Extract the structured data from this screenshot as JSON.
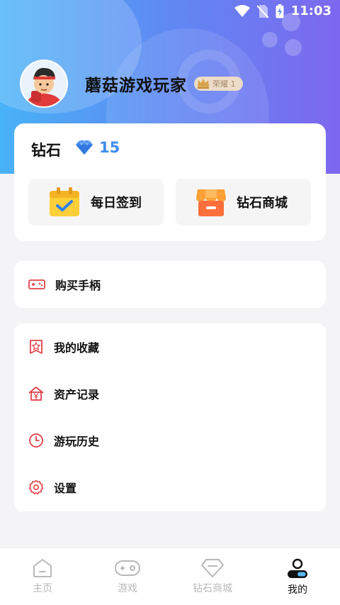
{
  "status_bar": {
    "time": "11:03"
  },
  "profile": {
    "username": "蘑菇游戏玩家",
    "badge_label": "荣耀 1"
  },
  "diamonds": {
    "label": "钻石",
    "count": "15",
    "actions": [
      {
        "label": "每日签到",
        "icon": "calendar-check-icon"
      },
      {
        "label": "钻石商城",
        "icon": "shop-icon"
      }
    ]
  },
  "menu_group_1": [
    {
      "label": "购买手柄",
      "icon": "gamepad-icon"
    }
  ],
  "menu_group_2": [
    {
      "label": "我的收藏",
      "icon": "star-bookmark-icon"
    },
    {
      "label": "资产记录",
      "icon": "asset-record-icon"
    },
    {
      "label": "游玩历史",
      "icon": "clock-icon"
    },
    {
      "label": "设置",
      "icon": "gear-icon"
    }
  ],
  "bottom_nav": [
    {
      "label": "主页",
      "icon": "home-icon",
      "active": false
    },
    {
      "label": "游戏",
      "icon": "controller-icon",
      "active": false
    },
    {
      "label": "钻石商城",
      "icon": "diamond-icon",
      "active": false
    },
    {
      "label": "我的",
      "icon": "user-icon",
      "active": true
    }
  ],
  "colors": {
    "accent_blue": "#3f8df0",
    "icon_red": "#e2424b",
    "active_nav": "#111111",
    "inactive_nav": "#b8b8b8"
  }
}
